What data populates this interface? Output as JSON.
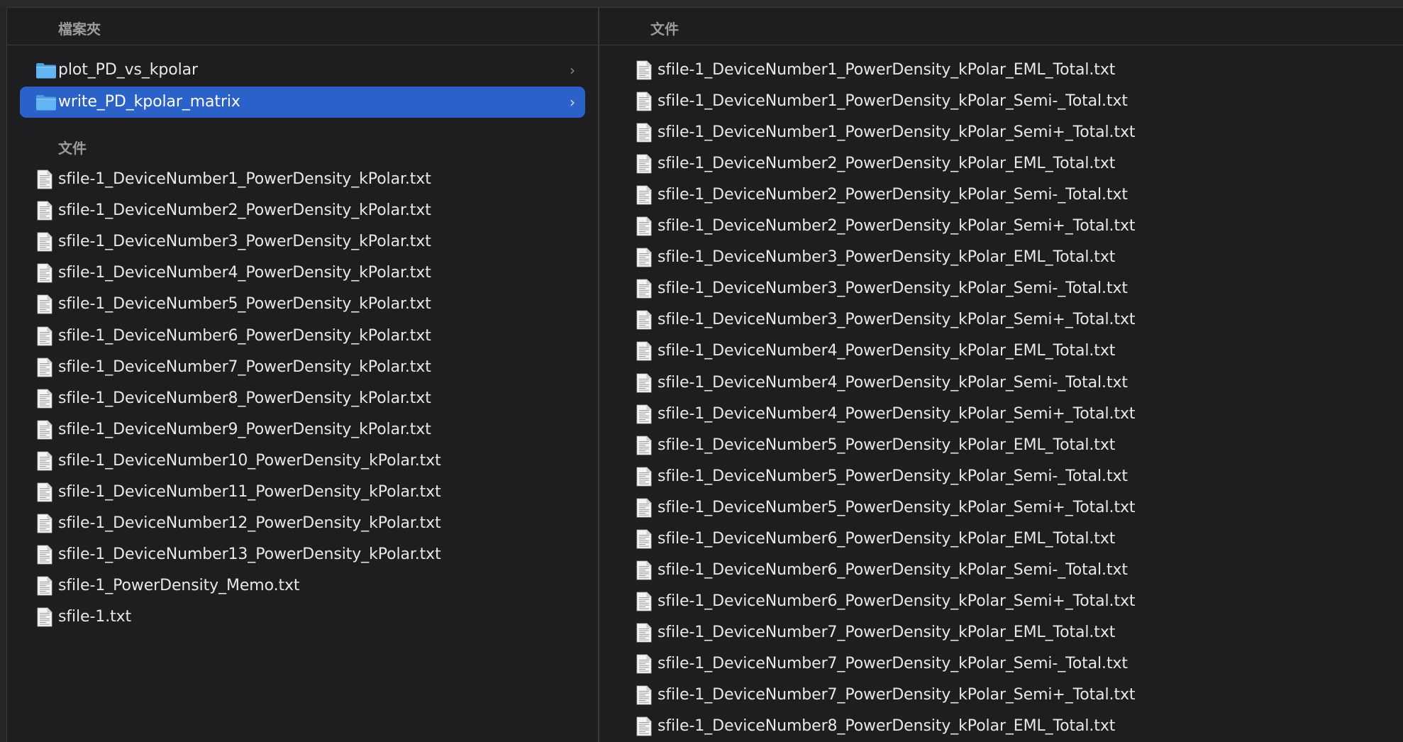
{
  "left_column": {
    "header": "檔案夾",
    "folders": [
      {
        "name": "plot_PD_vs_kpolar",
        "selected": false
      },
      {
        "name": "write_PD_kpolar_matrix",
        "selected": true
      }
    ],
    "files_section_label": "文件",
    "files": [
      "sfile-1_DeviceNumber1_PowerDensity_kPolar.txt",
      "sfile-1_DeviceNumber2_PowerDensity_kPolar.txt",
      "sfile-1_DeviceNumber3_PowerDensity_kPolar.txt",
      "sfile-1_DeviceNumber4_PowerDensity_kPolar.txt",
      "sfile-1_DeviceNumber5_PowerDensity_kPolar.txt",
      "sfile-1_DeviceNumber6_PowerDensity_kPolar.txt",
      "sfile-1_DeviceNumber7_PowerDensity_kPolar.txt",
      "sfile-1_DeviceNumber8_PowerDensity_kPolar.txt",
      "sfile-1_DeviceNumber9_PowerDensity_kPolar.txt",
      "sfile-1_DeviceNumber10_PowerDensity_kPolar.txt",
      "sfile-1_DeviceNumber11_PowerDensity_kPolar.txt",
      "sfile-1_DeviceNumber12_PowerDensity_kPolar.txt",
      "sfile-1_DeviceNumber13_PowerDensity_kPolar.txt",
      "sfile-1_PowerDensity_Memo.txt",
      "sfile-1.txt"
    ]
  },
  "right_column": {
    "header": "文件",
    "files": [
      "sfile-1_DeviceNumber1_PowerDensity_kPolar_EML_Total.txt",
      "sfile-1_DeviceNumber1_PowerDensity_kPolar_Semi-_Total.txt",
      "sfile-1_DeviceNumber1_PowerDensity_kPolar_Semi+_Total.txt",
      "sfile-1_DeviceNumber2_PowerDensity_kPolar_EML_Total.txt",
      "sfile-1_DeviceNumber2_PowerDensity_kPolar_Semi-_Total.txt",
      "sfile-1_DeviceNumber2_PowerDensity_kPolar_Semi+_Total.txt",
      "sfile-1_DeviceNumber3_PowerDensity_kPolar_EML_Total.txt",
      "sfile-1_DeviceNumber3_PowerDensity_kPolar_Semi-_Total.txt",
      "sfile-1_DeviceNumber3_PowerDensity_kPolar_Semi+_Total.txt",
      "sfile-1_DeviceNumber4_PowerDensity_kPolar_EML_Total.txt",
      "sfile-1_DeviceNumber4_PowerDensity_kPolar_Semi-_Total.txt",
      "sfile-1_DeviceNumber4_PowerDensity_kPolar_Semi+_Total.txt",
      "sfile-1_DeviceNumber5_PowerDensity_kPolar_EML_Total.txt",
      "sfile-1_DeviceNumber5_PowerDensity_kPolar_Semi-_Total.txt",
      "sfile-1_DeviceNumber5_PowerDensity_kPolar_Semi+_Total.txt",
      "sfile-1_DeviceNumber6_PowerDensity_kPolar_EML_Total.txt",
      "sfile-1_DeviceNumber6_PowerDensity_kPolar_Semi-_Total.txt",
      "sfile-1_DeviceNumber6_PowerDensity_kPolar_Semi+_Total.txt",
      "sfile-1_DeviceNumber7_PowerDensity_kPolar_EML_Total.txt",
      "sfile-1_DeviceNumber7_PowerDensity_kPolar_Semi-_Total.txt",
      "sfile-1_DeviceNumber7_PowerDensity_kPolar_Semi+_Total.txt",
      "sfile-1_DeviceNumber8_PowerDensity_kPolar_EML_Total.txt"
    ]
  },
  "colors": {
    "background": "#1e1e20",
    "selection": "#2a62c9",
    "folder_blue": "#5ab0f0",
    "section_label": "#9b9b9d",
    "text": "#e8e8e8"
  },
  "icons": {
    "folder": "folder-icon",
    "file": "text-file-icon",
    "disclosure": "chevron-right-icon"
  }
}
